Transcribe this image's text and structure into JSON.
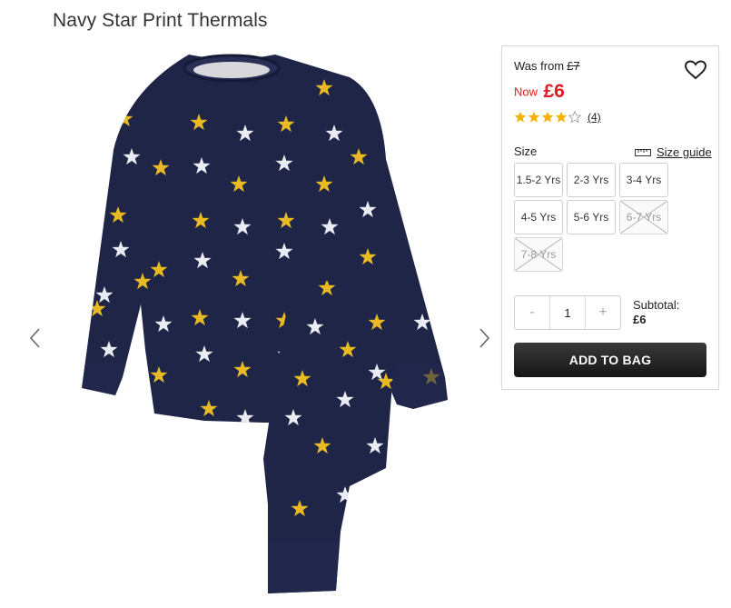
{
  "product": {
    "title": "Navy Star Print Thermals"
  },
  "icons": {
    "prev": "chevron-left-icon",
    "next": "chevron-right-icon",
    "wishlist": "heart-icon",
    "size_guide": "ruler-icon"
  },
  "colors": {
    "navy": "#1f2547",
    "star_yellow": "#e8b923",
    "star_white": "#e9ecf2",
    "price_red": "#e11b22",
    "rating_gold": "#f5b301"
  },
  "pricing": {
    "was_label": "Was from",
    "was_price": "£7",
    "now_label": "Now",
    "now_price": "£6"
  },
  "rating": {
    "stars": 4,
    "max": 5,
    "review_count": "(4)"
  },
  "size": {
    "label": "Size",
    "guide_label": "Size guide",
    "options": [
      {
        "label": "1.5-2 Yrs",
        "available": true
      },
      {
        "label": "2-3 Yrs",
        "available": true
      },
      {
        "label": "3-4 Yrs",
        "available": true
      },
      {
        "label": "4-5 Yrs",
        "available": true
      },
      {
        "label": "5-6 Yrs",
        "available": true
      },
      {
        "label": "6-7 Yrs",
        "available": false
      },
      {
        "label": "7-8 Yrs",
        "available": false
      }
    ]
  },
  "quantity": {
    "minus": "-",
    "value": "1",
    "plus": "+"
  },
  "subtotal": {
    "label": "Subtotal:",
    "value": "£6"
  },
  "cart": {
    "add_label": "ADD TO BAG"
  }
}
